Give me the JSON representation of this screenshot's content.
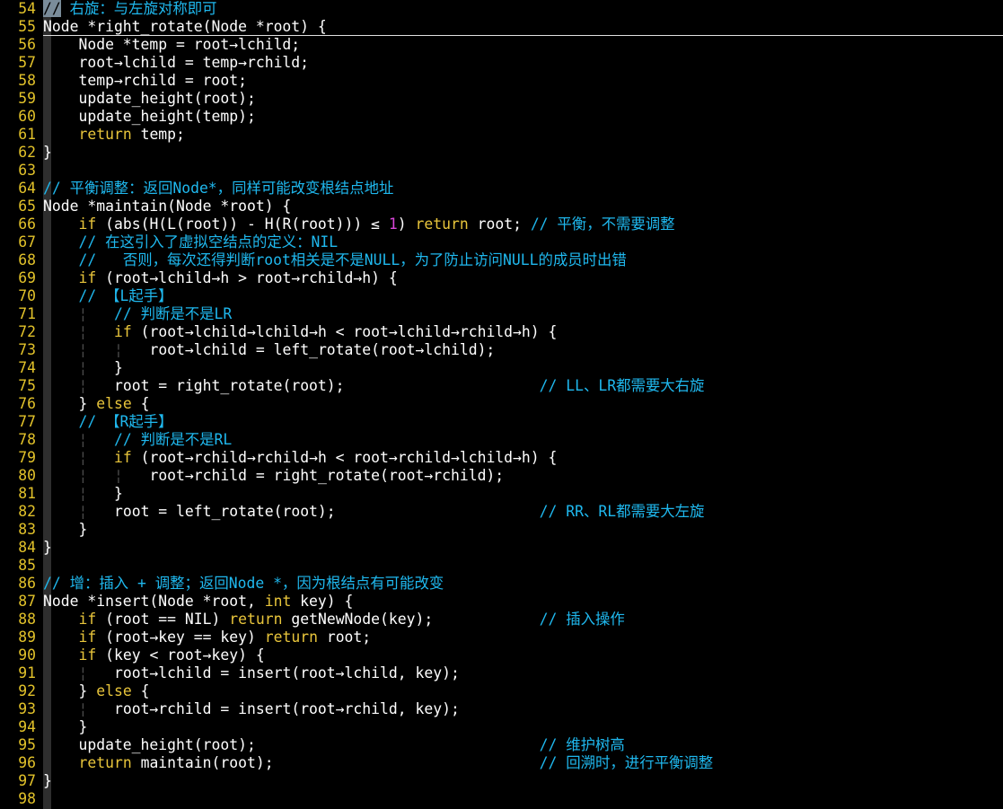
{
  "editor": {
    "colors": {
      "background": "#000000",
      "text": "#ffffff",
      "line_number": "#e2c22a",
      "comment": "#1fb8ee",
      "keyword": "#e8c53b",
      "number": "#d946d9",
      "indent_guide": "#4a4a4a"
    },
    "lines": [
      {
        "n": "54",
        "tokens": [
          {
            "t": "//",
            "c": "cur"
          },
          {
            "t": " 右旋：与左旋对称即可",
            "c": "cmt"
          }
        ]
      },
      {
        "n": "55",
        "tokens": [
          {
            "t": "Node *right_rotate(Node *root) {",
            "c": ""
          }
        ]
      },
      {
        "n": "56",
        "tokens": [
          {
            "t": "    Node *temp = root→lchild;",
            "c": ""
          }
        ]
      },
      {
        "n": "57",
        "tokens": [
          {
            "t": "    root→lchild = temp→rchild;",
            "c": ""
          }
        ]
      },
      {
        "n": "58",
        "tokens": [
          {
            "t": "    temp→rchild = root;",
            "c": ""
          }
        ]
      },
      {
        "n": "59",
        "tokens": [
          {
            "t": "    update_height(root);",
            "c": ""
          }
        ]
      },
      {
        "n": "60",
        "tokens": [
          {
            "t": "    update_height(temp);",
            "c": ""
          }
        ]
      },
      {
        "n": "61",
        "tokens": [
          {
            "t": "    ",
            "c": ""
          },
          {
            "t": "return",
            "c": "kw"
          },
          {
            "t": " temp;",
            "c": ""
          }
        ]
      },
      {
        "n": "62",
        "tokens": [
          {
            "t": "}",
            "c": ""
          }
        ]
      },
      {
        "n": "63",
        "tokens": []
      },
      {
        "n": "64",
        "tokens": [
          {
            "t": "// 平衡调整：返回Node*，同样可能改变根结点地址",
            "c": "cmt"
          }
        ]
      },
      {
        "n": "65",
        "tokens": [
          {
            "t": "Node *maintain(Node *root) {",
            "c": ""
          }
        ]
      },
      {
        "n": "66",
        "tokens": [
          {
            "t": "    ",
            "c": ""
          },
          {
            "t": "if",
            "c": "kw"
          },
          {
            "t": " (abs(H(L(root)) - H(R(root))) ≤ ",
            "c": ""
          },
          {
            "t": "1",
            "c": "num"
          },
          {
            "t": ") ",
            "c": ""
          },
          {
            "t": "return",
            "c": "kw"
          },
          {
            "t": " root; ",
            "c": ""
          },
          {
            "t": "// 平衡，不需要调整",
            "c": "cmt"
          }
        ]
      },
      {
        "n": "67",
        "tokens": [
          {
            "t": "    ",
            "c": ""
          },
          {
            "t": "// 在这引入了虚拟空结点的定义：NIL",
            "c": "cmt"
          }
        ]
      },
      {
        "n": "68",
        "tokens": [
          {
            "t": "    ",
            "c": ""
          },
          {
            "t": "//   否则，每次还得判断root相关是不是NULL，为了防止访问NULL的成员时出错",
            "c": "cmt"
          }
        ]
      },
      {
        "n": "69",
        "tokens": [
          {
            "t": "    ",
            "c": ""
          },
          {
            "t": "if",
            "c": "kw"
          },
          {
            "t": " (root→lchild→h > root→rchild→h) {",
            "c": ""
          }
        ]
      },
      {
        "n": "70",
        "tokens": [
          {
            "t": "    ",
            "c": ""
          },
          {
            "t": "// 【L起手】",
            "c": "cmt"
          }
        ]
      },
      {
        "n": "71",
        "tokens": [
          {
            "t": "    ",
            "c": ""
          },
          {
            "t": "¦",
            "c": "guide"
          },
          {
            "t": "   ",
            "c": ""
          },
          {
            "t": "// 判断是不是LR",
            "c": "cmt"
          }
        ]
      },
      {
        "n": "72",
        "tokens": [
          {
            "t": "    ",
            "c": ""
          },
          {
            "t": "¦",
            "c": "guide"
          },
          {
            "t": "   ",
            "c": ""
          },
          {
            "t": "if",
            "c": "kw"
          },
          {
            "t": " (root→lchild→lchild→h < root→lchild→rchild→h) {",
            "c": ""
          }
        ]
      },
      {
        "n": "73",
        "tokens": [
          {
            "t": "    ",
            "c": ""
          },
          {
            "t": "¦",
            "c": "guide"
          },
          {
            "t": "   ",
            "c": ""
          },
          {
            "t": "¦",
            "c": "guide"
          },
          {
            "t": "   root→lchild = left_rotate(root→lchild);",
            "c": ""
          }
        ]
      },
      {
        "n": "74",
        "tokens": [
          {
            "t": "    ",
            "c": ""
          },
          {
            "t": "¦",
            "c": "guide"
          },
          {
            "t": "   }",
            "c": ""
          }
        ]
      },
      {
        "n": "75",
        "tokens": [
          {
            "t": "    ",
            "c": ""
          },
          {
            "t": "¦",
            "c": "guide"
          },
          {
            "t": "   root = right_rotate(root);                      ",
            "c": ""
          },
          {
            "t": "// LL、LR都需要大右旋",
            "c": "cmt"
          }
        ]
      },
      {
        "n": "76",
        "tokens": [
          {
            "t": "    } ",
            "c": ""
          },
          {
            "t": "else",
            "c": "kw"
          },
          {
            "t": " {",
            "c": ""
          }
        ]
      },
      {
        "n": "77",
        "tokens": [
          {
            "t": "    ",
            "c": ""
          },
          {
            "t": "// 【R起手】",
            "c": "cmt"
          }
        ]
      },
      {
        "n": "78",
        "tokens": [
          {
            "t": "    ",
            "c": ""
          },
          {
            "t": "¦",
            "c": "guide"
          },
          {
            "t": "   ",
            "c": ""
          },
          {
            "t": "// 判断是不是RL",
            "c": "cmt"
          }
        ]
      },
      {
        "n": "79",
        "tokens": [
          {
            "t": "    ",
            "c": ""
          },
          {
            "t": "¦",
            "c": "guide"
          },
          {
            "t": "   ",
            "c": ""
          },
          {
            "t": "if",
            "c": "kw"
          },
          {
            "t": " (root→rchild→rchild→h < root→rchild→lchild→h) {",
            "c": ""
          }
        ]
      },
      {
        "n": "80",
        "tokens": [
          {
            "t": "    ",
            "c": ""
          },
          {
            "t": "¦",
            "c": "guide"
          },
          {
            "t": "   ",
            "c": ""
          },
          {
            "t": "¦",
            "c": "guide"
          },
          {
            "t": "   root→rchild = right_rotate(root→rchild);",
            "c": ""
          }
        ]
      },
      {
        "n": "81",
        "tokens": [
          {
            "t": "    ",
            "c": ""
          },
          {
            "t": "¦",
            "c": "guide"
          },
          {
            "t": "   }",
            "c": ""
          }
        ]
      },
      {
        "n": "82",
        "tokens": [
          {
            "t": "    ",
            "c": ""
          },
          {
            "t": "¦",
            "c": "guide"
          },
          {
            "t": "   root = left_rotate(root);                       ",
            "c": ""
          },
          {
            "t": "// RR、RL都需要大左旋",
            "c": "cmt"
          }
        ]
      },
      {
        "n": "83",
        "tokens": [
          {
            "t": "    }",
            "c": ""
          }
        ]
      },
      {
        "n": "84",
        "tokens": [
          {
            "t": "}",
            "c": ""
          }
        ]
      },
      {
        "n": "85",
        "tokens": []
      },
      {
        "n": "86",
        "tokens": [
          {
            "t": "// 增：插入 + 调整；返回Node *，因为根结点有可能改变",
            "c": "cmt"
          }
        ]
      },
      {
        "n": "87",
        "tokens": [
          {
            "t": "Node *insert(Node *root, ",
            "c": ""
          },
          {
            "t": "int",
            "c": "kw"
          },
          {
            "t": " key) {",
            "c": ""
          }
        ]
      },
      {
        "n": "88",
        "tokens": [
          {
            "t": "    ",
            "c": ""
          },
          {
            "t": "if",
            "c": "kw"
          },
          {
            "t": " (root == NIL) ",
            "c": ""
          },
          {
            "t": "return",
            "c": "kw"
          },
          {
            "t": " getNewNode(key);            ",
            "c": ""
          },
          {
            "t": "// 插入操作",
            "c": "cmt"
          }
        ]
      },
      {
        "n": "89",
        "tokens": [
          {
            "t": "    ",
            "c": ""
          },
          {
            "t": "if",
            "c": "kw"
          },
          {
            "t": " (root→key == key) ",
            "c": ""
          },
          {
            "t": "return",
            "c": "kw"
          },
          {
            "t": " root;",
            "c": ""
          }
        ]
      },
      {
        "n": "90",
        "tokens": [
          {
            "t": "    ",
            "c": ""
          },
          {
            "t": "if",
            "c": "kw"
          },
          {
            "t": " (key < root→key) {",
            "c": ""
          }
        ]
      },
      {
        "n": "91",
        "tokens": [
          {
            "t": "    ",
            "c": ""
          },
          {
            "t": "¦",
            "c": "guide"
          },
          {
            "t": "   root→lchild = insert(root→lchild, key);",
            "c": ""
          }
        ]
      },
      {
        "n": "92",
        "tokens": [
          {
            "t": "    } ",
            "c": ""
          },
          {
            "t": "else",
            "c": "kw"
          },
          {
            "t": " {",
            "c": ""
          }
        ]
      },
      {
        "n": "93",
        "tokens": [
          {
            "t": "    ",
            "c": ""
          },
          {
            "t": "¦",
            "c": "guide"
          },
          {
            "t": "   root→rchild = insert(root→rchild, key);",
            "c": ""
          }
        ]
      },
      {
        "n": "94",
        "tokens": [
          {
            "t": "    }",
            "c": ""
          }
        ]
      },
      {
        "n": "95",
        "tokens": [
          {
            "t": "    update_height(root);                                ",
            "c": ""
          },
          {
            "t": "// 维护树高",
            "c": "cmt"
          }
        ]
      },
      {
        "n": "96",
        "tokens": [
          {
            "t": "    ",
            "c": ""
          },
          {
            "t": "return",
            "c": "kw"
          },
          {
            "t": " maintain(root);                              ",
            "c": ""
          },
          {
            "t": "// 回溯时，进行平衡调整",
            "c": "cmt"
          }
        ]
      },
      {
        "n": "97",
        "tokens": [
          {
            "t": "}",
            "c": ""
          }
        ]
      },
      {
        "n": "98",
        "tokens": []
      }
    ]
  }
}
